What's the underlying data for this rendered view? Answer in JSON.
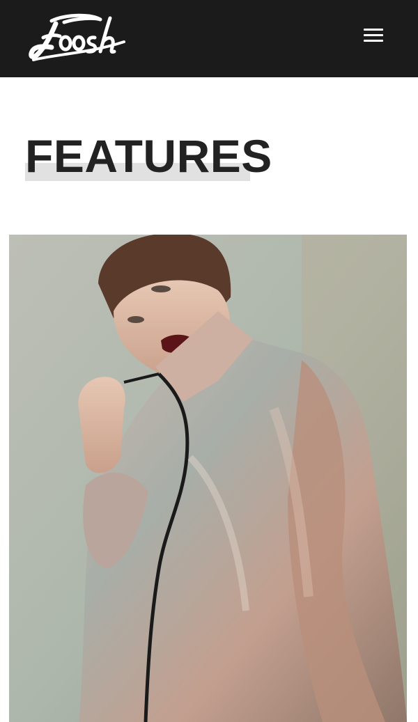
{
  "header": {
    "logo_text": "Foosh",
    "logo_icon": "foosh-script-logo",
    "menu_icon": "hamburger-menu-icon",
    "background_color": "#1b1b1b"
  },
  "main": {
    "section_title": "FEATURES",
    "title_color": "#222222",
    "highlight_color": "#e1e1e1",
    "feature_image": "photo-woman-in-metallic-jacket"
  }
}
